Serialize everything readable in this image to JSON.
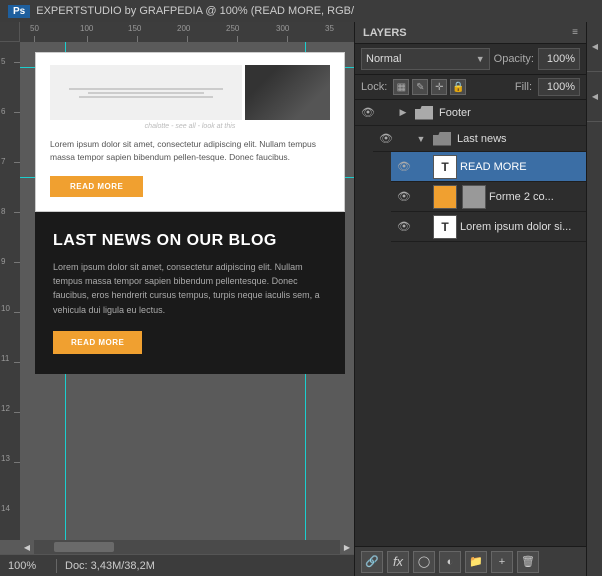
{
  "titlebar": {
    "ps_label": "Ps",
    "title": "EXPERTSTUDIO by GRAFPEDIA @ 100% (READ MORE, RGB/"
  },
  "layers_panel": {
    "title": "LAYERS",
    "blend_mode": "Normal",
    "opacity_label": "Opacity:",
    "opacity_value": "100%",
    "lock_label": "Lock:",
    "fill_label": "Fill:",
    "fill_value": "100%",
    "layers": [
      {
        "id": "footer",
        "type": "group",
        "name": "Footer",
        "indent": 0,
        "visible": true,
        "expanded": true
      },
      {
        "id": "last-news",
        "type": "group",
        "name": "Last news",
        "indent": 1,
        "visible": true,
        "expanded": true
      },
      {
        "id": "read-more",
        "type": "text",
        "name": "READ MORE",
        "indent": 2,
        "visible": true,
        "selected": true
      },
      {
        "id": "forme2",
        "type": "shape",
        "name": "Forme 2 co...",
        "indent": 2,
        "visible": true
      },
      {
        "id": "lorem-ipsum",
        "type": "text",
        "name": "Lorem ipsum dolor si...",
        "indent": 2,
        "visible": true
      }
    ],
    "bottom_tools": [
      "link",
      "fx",
      "mask",
      "adjustment",
      "group",
      "new",
      "trash"
    ]
  },
  "canvas": {
    "zoom": "100%",
    "doc_info": "Doc: 3,43M/38,2M",
    "scroll_arrows": [
      "◀",
      "▶"
    ]
  },
  "webpage": {
    "top_section": {
      "lorem_text": "Lorem ipsum dolor sit amet, consectetur adipiscing elit. Nullam tempus massa tempor sapien bibendum pellen-tesque. Donec faucibus.",
      "read_more_btn": "READ MORE"
    },
    "bottom_section": {
      "title": "LAST NEWS ON OUR BLOG",
      "lorem_text": "Lorem ipsum dolor sit amet, consectetur adipiscing elit. Nullam tempus massa tempor sapien bibendum pellentesque. Donec faucibus, eros hendrerit cursus tempus, turpis neque iaculis sem, a vehicula dui ligula eu lectus.",
      "read_more_btn": "READ MORE"
    }
  },
  "ruler": {
    "h_marks": [
      {
        "label": "50",
        "pos": 15
      },
      {
        "label": "100",
        "pos": 65
      },
      {
        "label": "150",
        "pos": 115
      },
      {
        "label": "200",
        "pos": 165
      },
      {
        "label": "250",
        "pos": 215
      },
      {
        "label": "300",
        "pos": 265
      },
      {
        "label": "35",
        "pos": 310
      }
    ],
    "v_marks": [
      {
        "label": "5",
        "pos": 18
      },
      {
        "label": "6",
        "pos": 68
      },
      {
        "label": "7",
        "pos": 118
      },
      {
        "label": "8",
        "pos": 168
      },
      {
        "label": "9",
        "pos": 218
      },
      {
        "label": "10",
        "pos": 268
      },
      {
        "label": "11",
        "pos": 318
      },
      {
        "label": "12",
        "pos": 368
      },
      {
        "label": "13",
        "pos": 418
      },
      {
        "label": "14",
        "pos": 468
      }
    ]
  }
}
